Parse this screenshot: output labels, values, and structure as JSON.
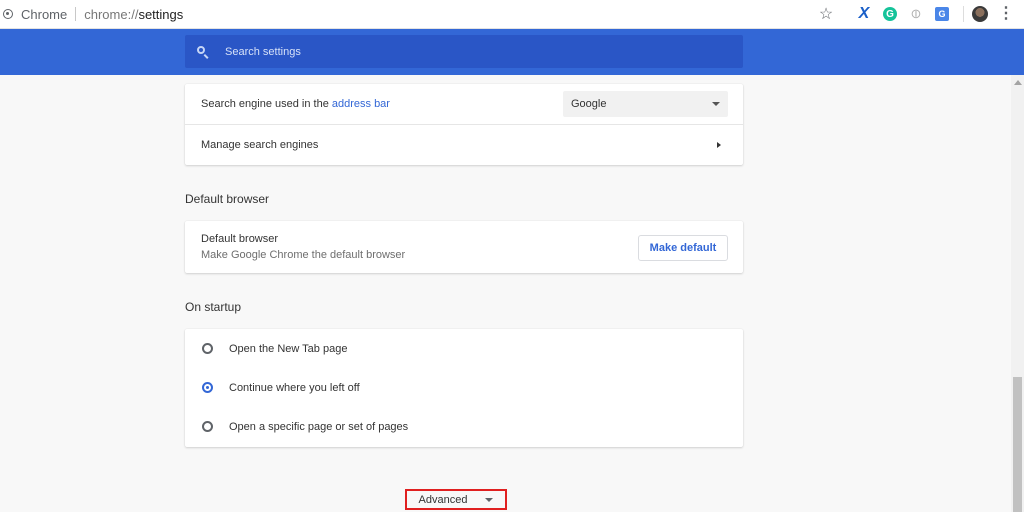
{
  "omnibox": {
    "origin_label": "Chrome",
    "url_scheme": "chrome://",
    "url_host": "settings"
  },
  "extensions": {
    "x_label": "X",
    "grammarly_label": "G",
    "translate_label": "G"
  },
  "search": {
    "placeholder": "Search settings"
  },
  "search_engine": {
    "label_prefix": "Search engine used in the ",
    "label_link": "address bar",
    "selected_engine": "Google",
    "manage_label": "Manage search engines"
  },
  "default_browser": {
    "section_title": "Default browser",
    "row_title": "Default browser",
    "row_subtitle": "Make Google Chrome the default browser",
    "button_label": "Make default"
  },
  "on_startup": {
    "section_title": "On startup",
    "options": [
      {
        "label": "Open the New Tab page",
        "checked": false
      },
      {
        "label": "Continue where you left off",
        "checked": true
      },
      {
        "label": "Open a specific page or set of pages",
        "checked": false
      }
    ]
  },
  "advanced": {
    "label": "Advanced"
  },
  "colors": {
    "header_blue": "#3367d6",
    "link_blue": "#3367d6",
    "highlight_red": "#e02020"
  }
}
